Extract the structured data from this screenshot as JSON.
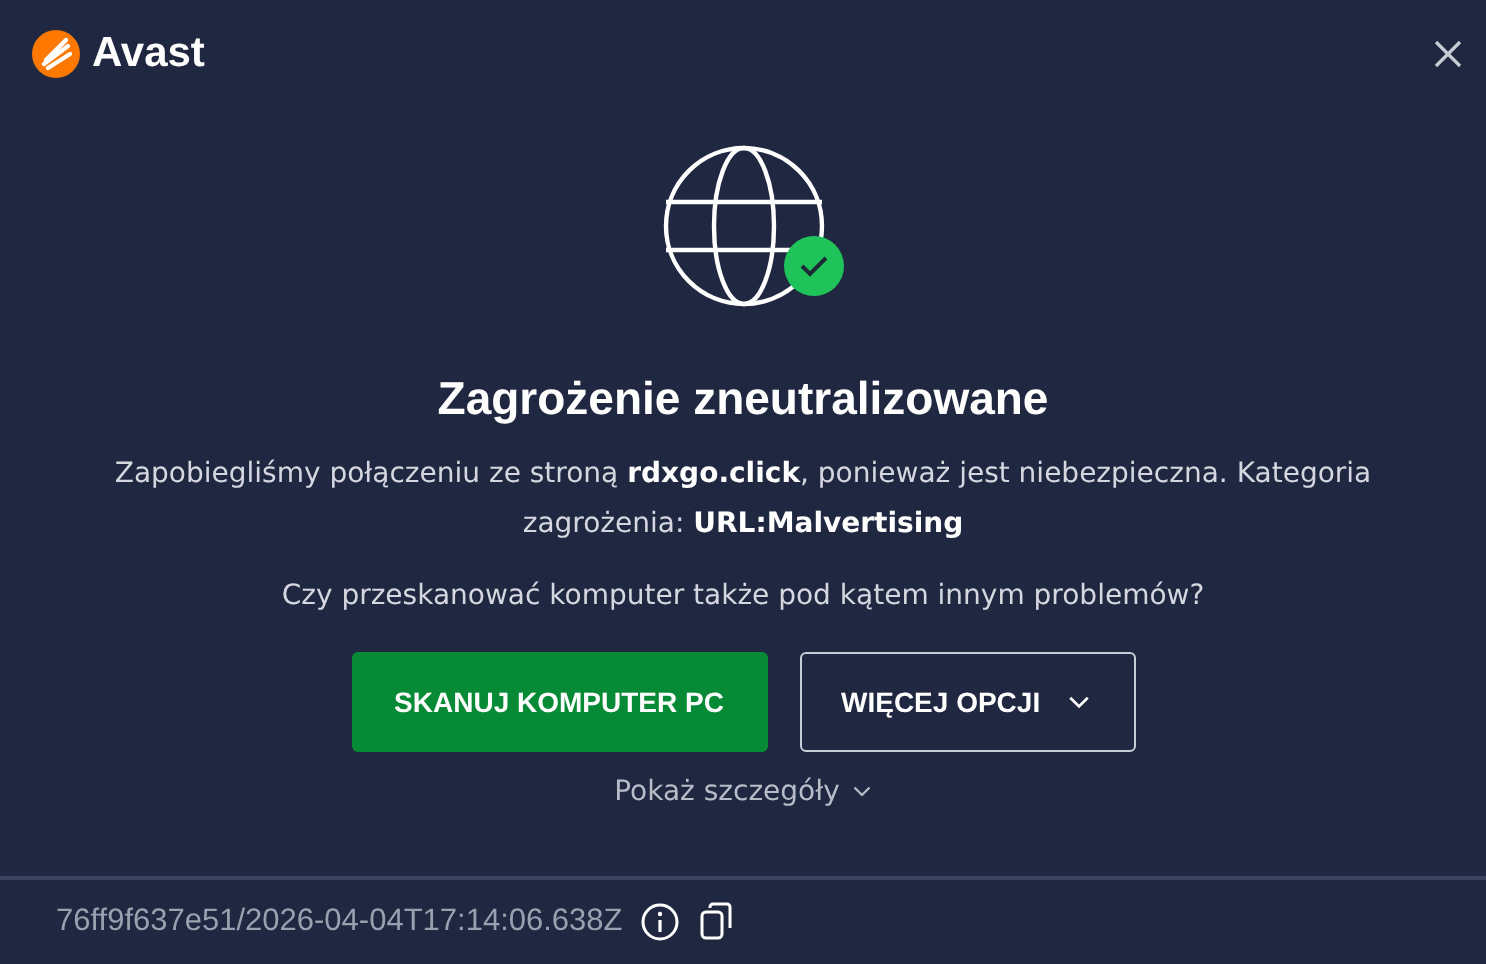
{
  "app": {
    "name": "Avast"
  },
  "title": "Zagrożenie zneutralizowane",
  "message": "Zapobiegliśmy połączeniu ze stroną **rdxgo.click**, ponieważ jest niebezpieczna. Kategoria zagrożenia: **URL:Malvertising**",
  "question": "Czy przeskanować komputer także pod kątem innym problemów?",
  "buttons": [
    {
      "label": "SKANUJ KOMPUTER PC",
      "kind": "primary"
    },
    {
      "label": "WIĘCEJ OPCJI",
      "kind": "dropdown"
    }
  ],
  "details_link": "Pokaż szczegóły",
  "footer": {
    "id": "76ff9f637e51/2026-04-04T17:14:06.638Z"
  }
}
